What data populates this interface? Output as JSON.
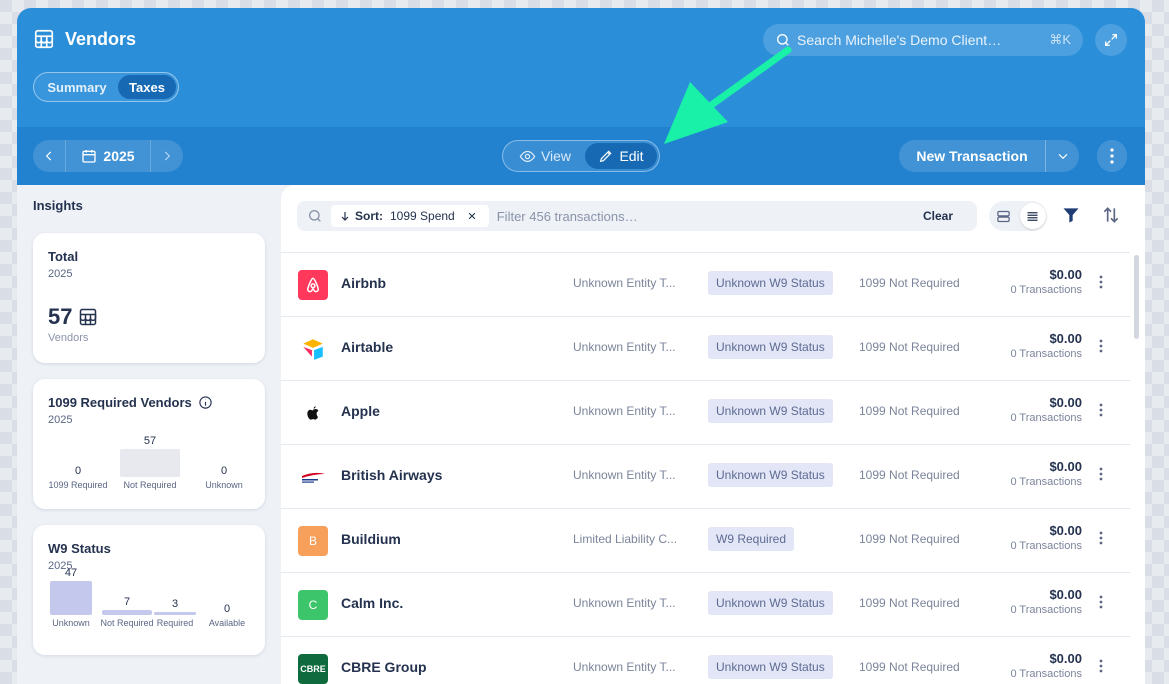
{
  "header": {
    "title": "Vendors",
    "tabs": [
      {
        "label": "Summary"
      },
      {
        "label": "Taxes"
      }
    ],
    "search_placeholder": "Search Michelle's Demo Client…",
    "search_shortcut": "⌘K"
  },
  "toolbar": {
    "year": "2025",
    "view_label": "View",
    "edit_label": "Edit",
    "new_transaction_label": "New Transaction"
  },
  "insights": {
    "heading": "Insights",
    "total": {
      "title": "Total",
      "year": "2025",
      "value": "57",
      "unit": "Vendors"
    },
    "required": {
      "title": "1099 Required Vendors",
      "year": "2025",
      "bars": [
        {
          "label": "1099 Required",
          "value": "0",
          "fraction": 0
        },
        {
          "label": "Not Required",
          "value": "57",
          "fraction": 1
        },
        {
          "label": "Unknown",
          "value": "0",
          "fraction": 0
        }
      ]
    },
    "w9": {
      "title": "W9 Status",
      "year": "2025",
      "bars": [
        {
          "label": "Unknown",
          "value": "47",
          "fraction": 1
        },
        {
          "label": "Not Required",
          "value": "7",
          "fraction": 0.149
        },
        {
          "label": "Required",
          "value": "3",
          "fraction": 0.064
        },
        {
          "label": "Available",
          "value": "0",
          "fraction": 0
        }
      ]
    }
  },
  "filter": {
    "sort_prefix": "Sort:",
    "sort_value": "1099 Spend",
    "placeholder": "Filter 456 transactions…",
    "clear_label": "Clear"
  },
  "vendors": [
    {
      "name": "Airbnb",
      "entity": "Unknown Entity T...",
      "w9": "Unknown W9 Status",
      "req": "1099 Not Required",
      "amount": "$0.00",
      "count": "0 Transactions",
      "logo_text": "",
      "logo_color": "#ff385c"
    },
    {
      "name": "Airtable",
      "entity": "Unknown Entity T...",
      "w9": "Unknown W9 Status",
      "req": "1099 Not Required",
      "amount": "$0.00",
      "count": "0 Transactions",
      "logo_text": "",
      "logo_color": "#ffffff"
    },
    {
      "name": "Apple",
      "entity": "Unknown Entity T...",
      "w9": "Unknown W9 Status",
      "req": "1099 Not Required",
      "amount": "$0.00",
      "count": "0 Transactions",
      "logo_text": "",
      "logo_color": "#ffffff"
    },
    {
      "name": "British Airways",
      "entity": "Unknown Entity T...",
      "w9": "Unknown W9 Status",
      "req": "1099 Not Required",
      "amount": "$0.00",
      "count": "0 Transactions",
      "logo_text": "",
      "logo_color": "#ffffff"
    },
    {
      "name": "Buildium",
      "entity": "Limited Liability C...",
      "w9": "W9 Required",
      "req": "1099 Not Required",
      "amount": "$0.00",
      "count": "0 Transactions",
      "logo_text": "B",
      "logo_color": "#f6a05c"
    },
    {
      "name": "Calm Inc.",
      "entity": "Unknown Entity T...",
      "w9": "Unknown W9 Status",
      "req": "1099 Not Required",
      "amount": "$0.00",
      "count": "0 Transactions",
      "logo_text": "C",
      "logo_color": "#3dc56b"
    },
    {
      "name": "CBRE Group",
      "entity": "Unknown Entity T...",
      "w9": "Unknown W9 Status",
      "req": "1099 Not Required",
      "amount": "$0.00",
      "count": "0 Transactions",
      "logo_text": "CBRE",
      "logo_color": "#0f6b3e"
    }
  ],
  "colors": {
    "brand": "#2a8ed9",
    "accent_arrow": "#19f0a8",
    "bar": "#c4c8ec"
  }
}
